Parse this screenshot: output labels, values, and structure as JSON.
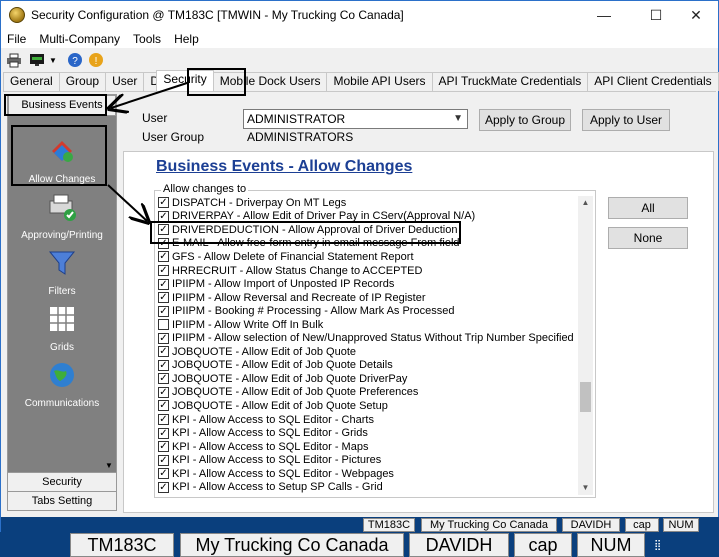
{
  "window": {
    "title": "Security Configuration @ TM183C [TMWIN - My Trucking Co Canada]",
    "minimize": "—",
    "maximize": "☐",
    "close": "✕"
  },
  "menu": [
    "File",
    "Multi-Company",
    "Tools",
    "Help"
  ],
  "tabs": [
    "General",
    "Group",
    "User",
    "DB Rights",
    "Security",
    "Mobile Dock Users",
    "Mobile API Users",
    "API TruckMate Credentials",
    "API Client Credentials"
  ],
  "sidebar": {
    "header": "Business Events",
    "items": [
      "Allow Changes",
      "Approving/Printing",
      "Filters",
      "Grids",
      "Communications"
    ],
    "bottom": [
      "Security",
      "Tabs Setting"
    ]
  },
  "user": {
    "user_label": "User",
    "group_label": "User Group",
    "user_value": "ADMINISTRATOR",
    "group_value": "ADMINISTRATORS",
    "apply_group": "Apply to Group",
    "apply_user": "Apply to User"
  },
  "panel": {
    "title": "Business Events - Allow Changes",
    "group_caption": "Allow changes to",
    "all_button": "All",
    "none_button": "None",
    "items": [
      {
        "label": "DISPATCH - Driverpay On MT Legs",
        "checked": true
      },
      {
        "label": "DRIVERPAY - Allow Edit of Driver Pay in CServ(Approval N/A)",
        "checked": true
      },
      {
        "label": "DRIVERDEDUCTION - Allow Approval of  Driver Deduction",
        "checked": true
      },
      {
        "label": "E-MAIL - Allow free-form entry in email message From field",
        "checked": true
      },
      {
        "label": "GFS -  Allow Delete of Financial Statement Report",
        "checked": true
      },
      {
        "label": "HRRECRUIT - Allow Status Change to ACCEPTED",
        "checked": true
      },
      {
        "label": "IPIIPM - Allow Import of Unposted IP Records",
        "checked": true
      },
      {
        "label": "IPIIPM - Allow Reversal and Recreate of IP Register",
        "checked": true
      },
      {
        "label": "IPIIPM - Booking # Processing - Allow Mark As Processed",
        "checked": true
      },
      {
        "label": "IPIIPM - Allow Write Off In Bulk",
        "checked": false
      },
      {
        "label": "IPIIPM - Allow selection of New/Unapproved Status Without Trip Number Specified",
        "checked": true
      },
      {
        "label": "JOBQUOTE - Allow Edit of Job Quote",
        "checked": true
      },
      {
        "label": "JOBQUOTE - Allow Edit of Job Quote Details",
        "checked": true
      },
      {
        "label": "JOBQUOTE - Allow Edit of Job Quote DriverPay",
        "checked": true
      },
      {
        "label": "JOBQUOTE - Allow Edit of Job Quote Preferences",
        "checked": true
      },
      {
        "label": "JOBQUOTE - Allow Edit of Job Quote Setup",
        "checked": true
      },
      {
        "label": "KPI - Allow Access to SQL Editor - Charts",
        "checked": true
      },
      {
        "label": "KPI - Allow Access to SQL Editor - Grids",
        "checked": true
      },
      {
        "label": "KPI - Allow Access to SQL Editor - Maps",
        "checked": true
      },
      {
        "label": "KPI - Allow Access to SQL Editor - Pictures",
        "checked": true
      },
      {
        "label": "KPI - Allow Access to SQL Editor - Webpages",
        "checked": true
      },
      {
        "label": "KPI - Allow Access to Setup SP Calls - Grid",
        "checked": true
      }
    ]
  },
  "status": [
    "TM183C",
    "My Trucking Co Canada",
    "DAVIDH",
    "cap",
    "NUM"
  ],
  "icons": [
    "app-shield-icon",
    "printer-icon",
    "monitor-icon",
    "help-icon",
    "info-icon",
    "checkmark-icon",
    "arrow-icon"
  ]
}
